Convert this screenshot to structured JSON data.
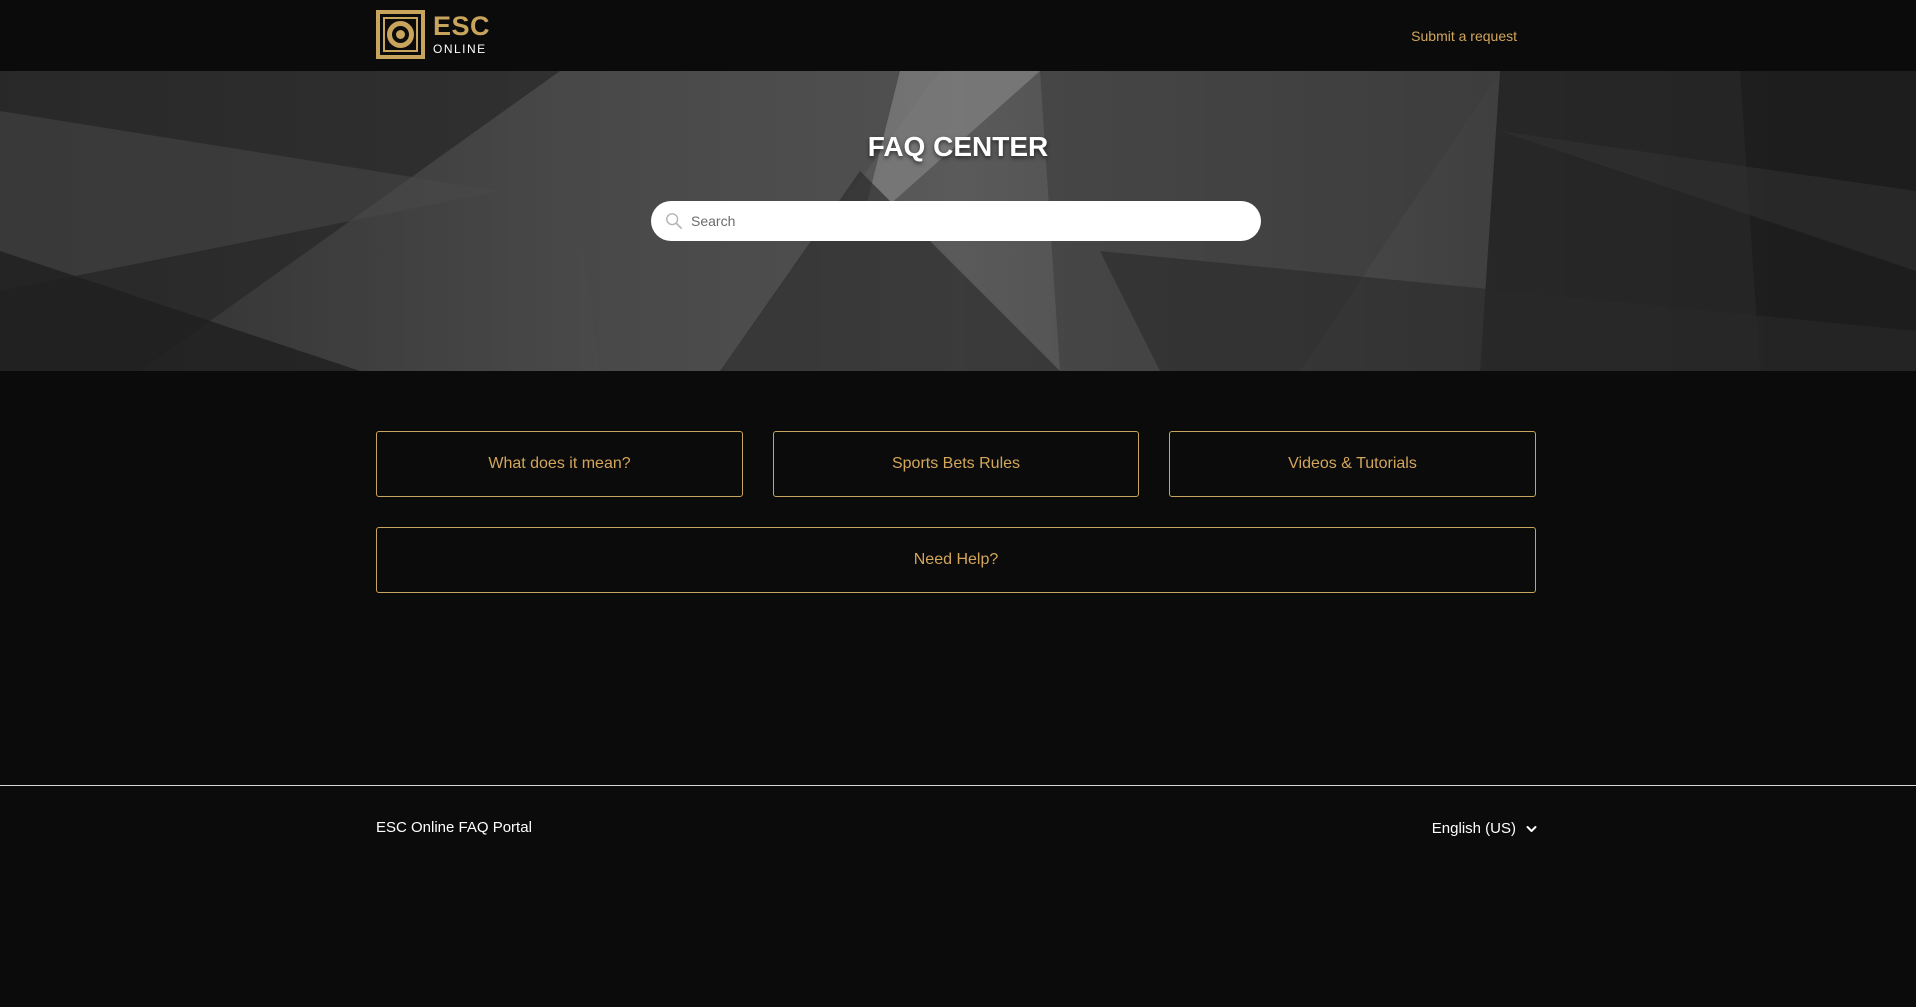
{
  "header": {
    "logo": {
      "title": "ESC",
      "subtitle": "ONLINE"
    },
    "submit_link": "Submit a request"
  },
  "hero": {
    "title": "FAQ CENTER",
    "search": {
      "placeholder": "Search",
      "value": ""
    }
  },
  "categories": [
    {
      "label": "What does it mean?"
    },
    {
      "label": "Sports Bets Rules"
    },
    {
      "label": "Videos & Tutorials"
    },
    {
      "label": "Need Help?"
    }
  ],
  "footer": {
    "title": "ESC Online FAQ Portal",
    "language": "English (US)"
  },
  "colors": {
    "accent": "#c9a45c",
    "background": "#0b0b0b",
    "text": "#ffffff"
  },
  "icons": [
    "search-icon",
    "chevron-down-icon"
  ]
}
